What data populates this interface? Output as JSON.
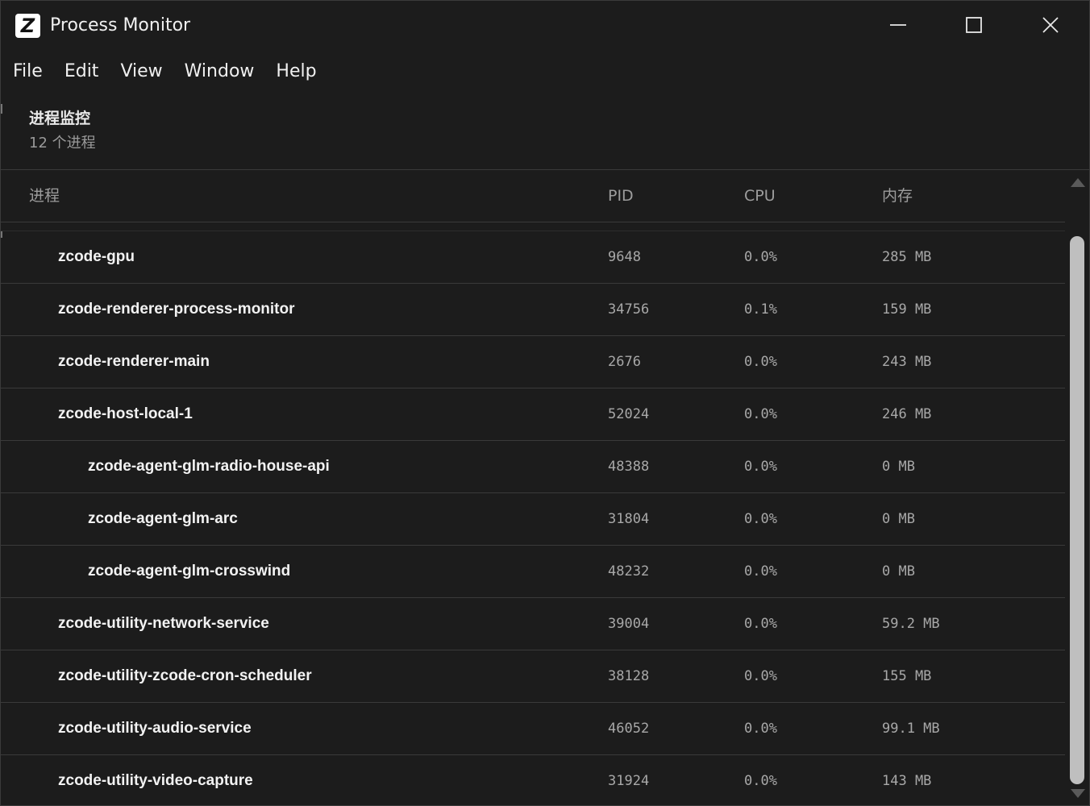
{
  "window": {
    "title": "Process Monitor",
    "logo_letter": "Z"
  },
  "menu": [
    "File",
    "Edit",
    "View",
    "Window",
    "Help"
  ],
  "header": {
    "title": "进程监控",
    "count": "12 个进程"
  },
  "table": {
    "columns": {
      "name": "进程",
      "pid": "PID",
      "cpu": "CPU",
      "memory": "内存"
    },
    "rows": [
      {
        "name": "zcode-gpu",
        "depth": 1,
        "pid": "9648",
        "cpu": "0.0%",
        "memory": "285 MB"
      },
      {
        "name": "zcode-renderer-process-monitor",
        "depth": 1,
        "pid": "34756",
        "cpu": "0.1%",
        "memory": "159 MB"
      },
      {
        "name": "zcode-renderer-main",
        "depth": 1,
        "pid": "2676",
        "cpu": "0.0%",
        "memory": "243 MB"
      },
      {
        "name": "zcode-host-local-1",
        "depth": 1,
        "pid": "52024",
        "cpu": "0.0%",
        "memory": "246 MB"
      },
      {
        "name": "zcode-agent-glm-radio-house-api",
        "depth": 2,
        "pid": "48388",
        "cpu": "0.0%",
        "memory": "0 MB"
      },
      {
        "name": "zcode-agent-glm-arc",
        "depth": 2,
        "pid": "31804",
        "cpu": "0.0%",
        "memory": "0 MB"
      },
      {
        "name": "zcode-agent-glm-crosswind",
        "depth": 2,
        "pid": "48232",
        "cpu": "0.0%",
        "memory": "0 MB"
      },
      {
        "name": "zcode-utility-network-service",
        "depth": 1,
        "pid": "39004",
        "cpu": "0.0%",
        "memory": "59.2 MB"
      },
      {
        "name": "zcode-utility-zcode-cron-scheduler",
        "depth": 1,
        "pid": "38128",
        "cpu": "0.0%",
        "memory": "155 MB"
      },
      {
        "name": "zcode-utility-audio-service",
        "depth": 1,
        "pid": "46052",
        "cpu": "0.0%",
        "memory": "99.1 MB"
      },
      {
        "name": "zcode-utility-video-capture",
        "depth": 1,
        "pid": "31924",
        "cpu": "0.0%",
        "memory": "143 MB"
      }
    ]
  },
  "icons": {
    "minimize": "minimize-icon",
    "maximize": "maximize-icon",
    "close": "close-icon"
  },
  "colors": {
    "background": "#1c1c1c",
    "text": "#f2f2f2",
    "muted": "#9d9d9d",
    "divider": "#3a3a3a"
  }
}
